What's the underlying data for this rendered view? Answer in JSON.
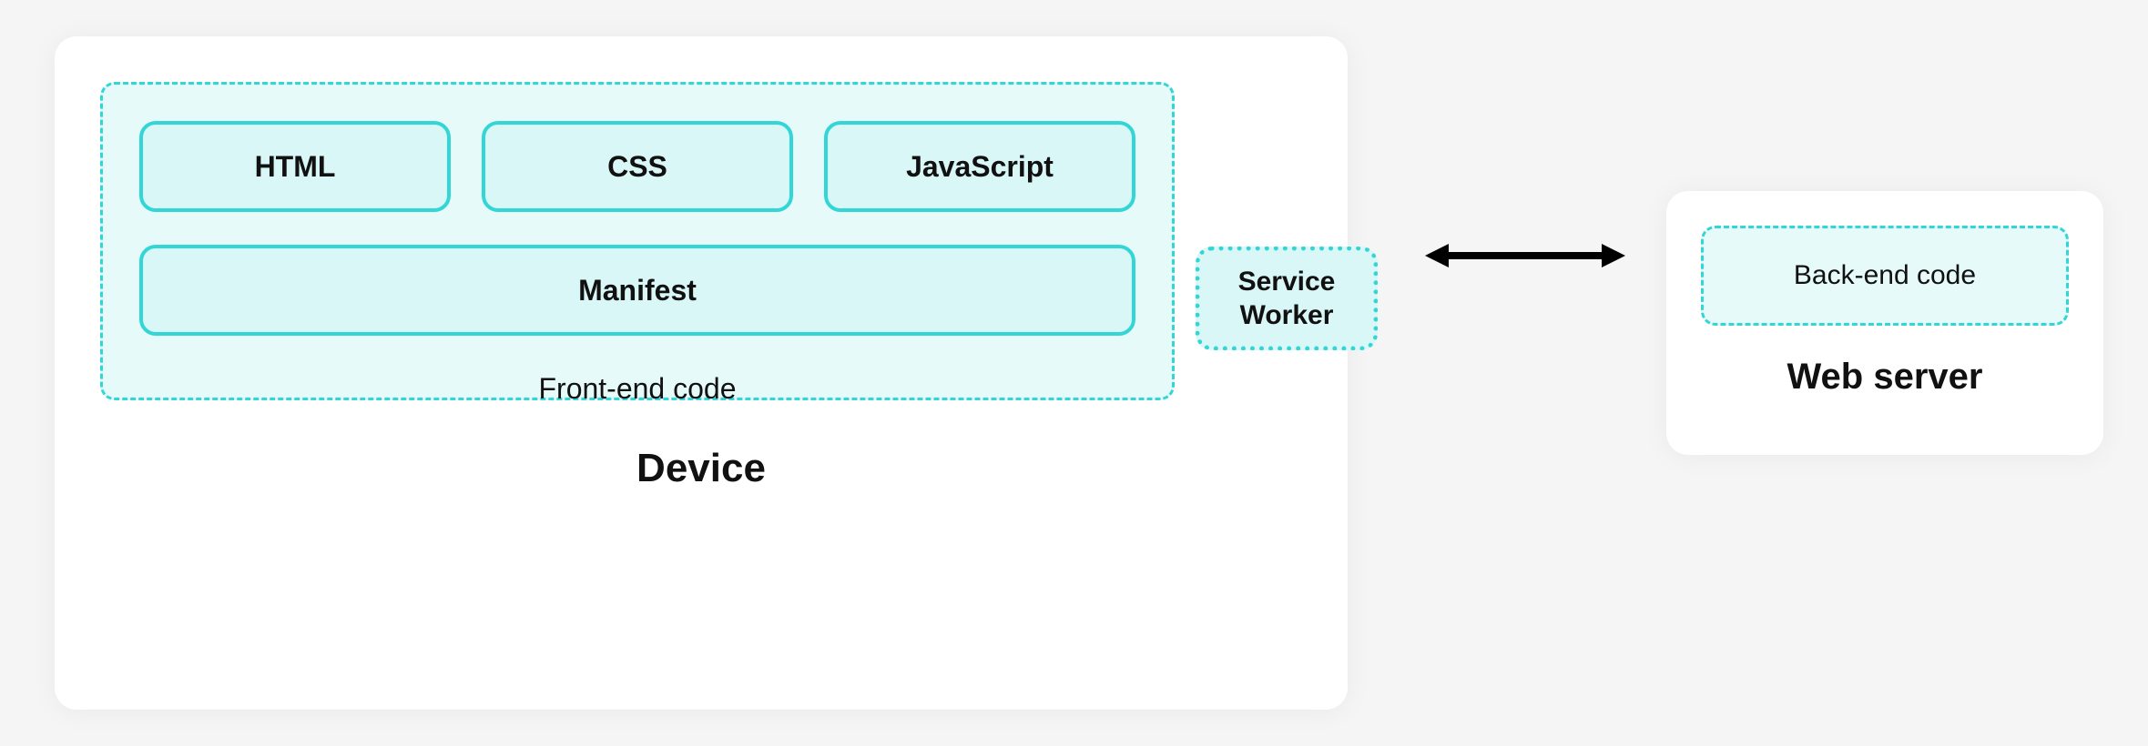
{
  "device": {
    "title": "Device",
    "frontend": {
      "label": "Front-end code",
      "items": {
        "html": "HTML",
        "css": "CSS",
        "js": "JavaScript",
        "manifest": "Manifest"
      },
      "service_worker": "Service\nWorker"
    }
  },
  "server": {
    "title": "Web server",
    "backend_label": "Back-end code"
  }
}
